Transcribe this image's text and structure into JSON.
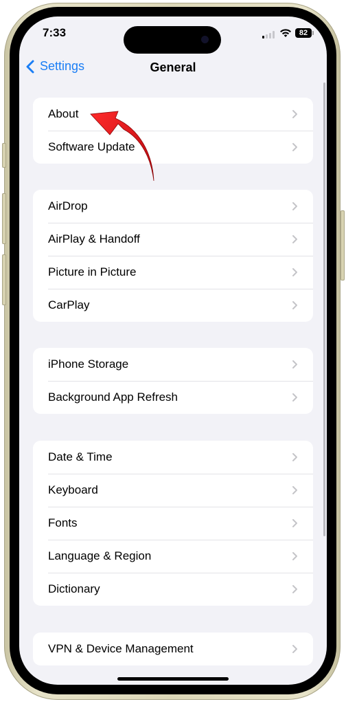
{
  "status_bar": {
    "time": "7:33",
    "battery_percent": "82",
    "signal_bars_active": 1,
    "signal_bars_total": 4
  },
  "nav": {
    "back_label": "Settings",
    "title": "General"
  },
  "groups": [
    {
      "items": [
        {
          "label": "About"
        },
        {
          "label": "Software Update"
        }
      ]
    },
    {
      "items": [
        {
          "label": "AirDrop"
        },
        {
          "label": "AirPlay & Handoff"
        },
        {
          "label": "Picture in Picture"
        },
        {
          "label": "CarPlay"
        }
      ]
    },
    {
      "items": [
        {
          "label": "iPhone Storage"
        },
        {
          "label": "Background App Refresh"
        }
      ]
    },
    {
      "items": [
        {
          "label": "Date & Time"
        },
        {
          "label": "Keyboard"
        },
        {
          "label": "Fonts"
        },
        {
          "label": "Language & Region"
        },
        {
          "label": "Dictionary"
        }
      ]
    },
    {
      "items": [
        {
          "label": "VPN & Device Management"
        }
      ]
    }
  ],
  "annotation": {
    "type": "red-curved-arrow",
    "points_to": "About",
    "color": "#e0141c"
  },
  "colors": {
    "accent": "#1a7ef5",
    "background": "#f2f2f7",
    "chevron": "#c4c4c8"
  }
}
